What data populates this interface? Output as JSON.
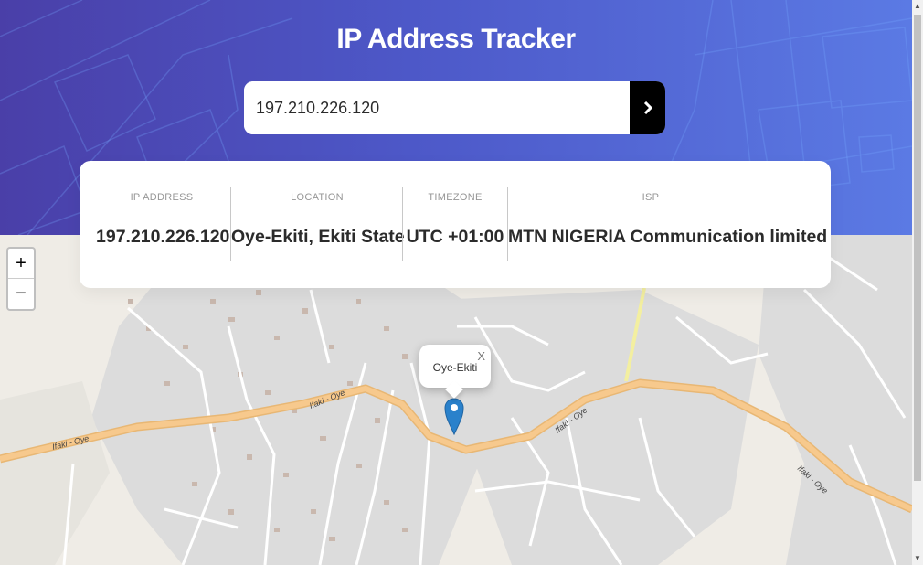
{
  "header": {
    "title": "IP Address Tracker"
  },
  "search": {
    "value": "197.210.226.120",
    "submit_icon": "chevron-right-icon"
  },
  "info": {
    "ip_label": "IP ADDRESS",
    "ip_value": "197.210.226.120",
    "location_label": "LOCATION",
    "location_value": "Oye-Ekiti, Ekiti State",
    "timezone_label": "TIMEZONE",
    "timezone_value": "UTC +01:00",
    "isp_label": "ISP",
    "isp_value": "MTN NIGERIA Communication limited"
  },
  "map": {
    "zoom_in": "+",
    "zoom_out": "−",
    "popup_text": "Oye-Ekiti",
    "popup_close": "X",
    "road_labels": [
      "Ifaki - Oye",
      "Ifaki - Oye",
      "Ifaki - Oye",
      "Ifaki - Oye"
    ],
    "marker_color": "#2a81cb",
    "road_color": "#f7c98d"
  },
  "colors": {
    "header_start": "#4a3fa8",
    "header_end": "#5b7ae4",
    "button": "#000000"
  }
}
